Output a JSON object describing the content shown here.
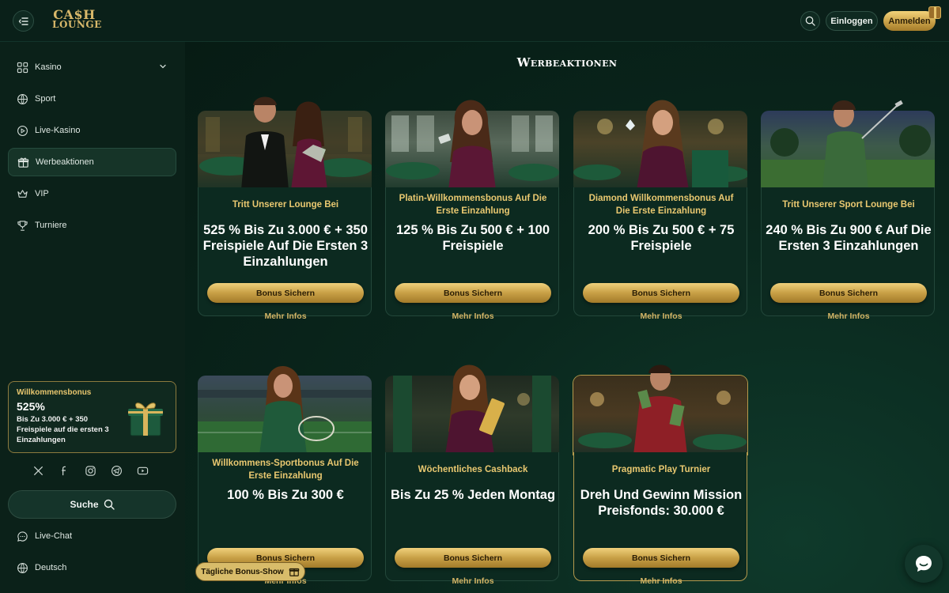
{
  "header": {
    "logo_line1": "CA$H",
    "logo_line2": "LOUNGE",
    "login_label": "Einloggen",
    "register_label": "Anmelden"
  },
  "sidebar": {
    "items": [
      {
        "label": "Kasino",
        "icon": "grid-icon"
      },
      {
        "label": "Sport",
        "icon": "ball-icon"
      },
      {
        "label": "Live-Kasino",
        "icon": "play-icon"
      },
      {
        "label": "Werbeaktionen",
        "icon": "gift-icon"
      },
      {
        "label": "VIP",
        "icon": "crown-icon"
      },
      {
        "label": "Turniere",
        "icon": "trophy-icon"
      }
    ],
    "active_item": "Werbeaktionen",
    "bonus": {
      "title": "Willkommensbonus",
      "percent": "525%",
      "desc": "Bis Zu 3.000 € + 350 Freispiele auf die ersten 3 Einzahlungen"
    },
    "search_label": "Suche",
    "livechat_label": "Live-Chat",
    "language_label": "Deutsch"
  },
  "main": {
    "title": "Werbeaktionen",
    "promos": [
      {
        "title": "Tritt Unserer Lounge Bei",
        "offer": "525 % Bis Zu 3.000 € + 350 Freispiele Auf Die Ersten 3 Einzahlungen",
        "cta": "Bonus Sichern",
        "more": "Mehr Infos"
      },
      {
        "title": "Platin-Willkommensbonus Auf Die Erste Einzahlung",
        "offer": "125 % Bis Zu 500 € + 100 Freispiele",
        "cta": "Bonus Sichern",
        "more": "Mehr Infos"
      },
      {
        "title": "Diamond Willkommensbonus Auf Die Erste Einzahlung",
        "offer": "200 % Bis Zu 500 € + 75 Freispiele",
        "cta": "Bonus Sichern",
        "more": "Mehr Infos"
      },
      {
        "title": "Tritt Unserer Sport Lounge Bei",
        "offer": "240 % Bis Zu 900 € Auf Die Ersten 3 Einzahlungen",
        "cta": "Bonus Sichern",
        "more": "Mehr Infos"
      },
      {
        "title": "Willkommens-Sportbonus Auf Die Erste Einzahlung",
        "offer": "100 % Bis Zu 300 €",
        "cta": "Bonus Sichern",
        "more": "Mehr Infos"
      },
      {
        "title": "Wöchentliches Cashback",
        "offer": "Bis Zu 25 % Jeden Montag",
        "cta": "Bonus Sichern",
        "more": "Mehr Infos"
      },
      {
        "title": "Pragmatic Play Turnier",
        "offer": "Dreh Und Gewinn Mission Preisfonds: 30.000 €",
        "cta": "Bonus Sichern",
        "more": "Mehr Infos"
      }
    ],
    "daily_bonus_label": "Tägliche Bonus-Show"
  },
  "colors": {
    "accent_gold": "#e9c870",
    "background": "#071a14",
    "card": "#0c2a20"
  }
}
